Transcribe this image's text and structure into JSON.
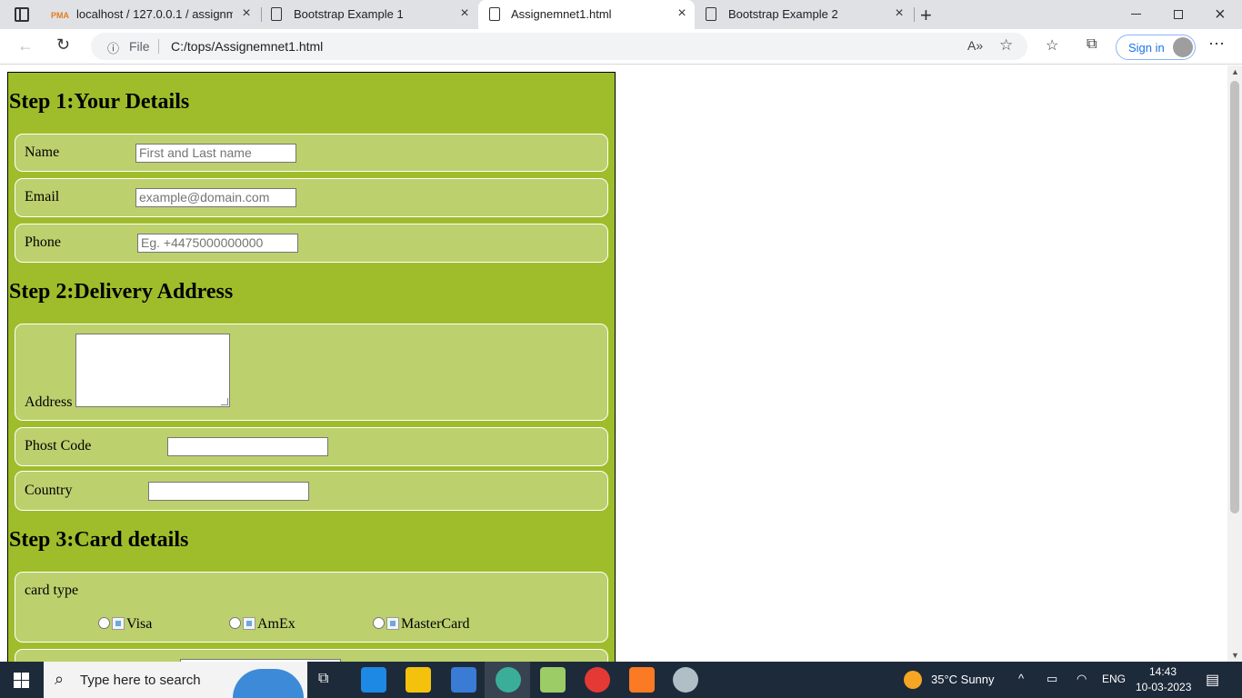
{
  "browser": {
    "tabs": [
      {
        "title": "localhost / 127.0.0.1 / assignmen",
        "icon": "phpmyadmin-icon",
        "active": false
      },
      {
        "title": "Bootstrap Example 1",
        "icon": "page-icon",
        "active": false
      },
      {
        "title": "Assignemnet1.html",
        "icon": "page-icon",
        "active": true
      },
      {
        "title": "Bootstrap Example 2",
        "icon": "page-icon",
        "active": false
      }
    ],
    "address": {
      "scheme_label": "File",
      "url": "C:/tops/Assignemnet1.html"
    },
    "sign_in_label": "Sign in"
  },
  "form": {
    "step1": {
      "heading": "Step 1:Your Details",
      "name_label": "Name",
      "name_placeholder": "First and Last name",
      "email_label": "Email",
      "email_placeholder": "example@domain.com",
      "phone_label": "Phone",
      "phone_placeholder": "Eg. +4475000000000"
    },
    "step2": {
      "heading": "Step 2:Delivery Address",
      "address_label": "Address",
      "postcode_label": "Phost Code",
      "country_label": "Country"
    },
    "step3": {
      "heading": "Step 3:Card details",
      "card_type_label": "card type",
      "options": [
        "Visa",
        "AmEx",
        "MasterCard"
      ]
    }
  },
  "taskbar": {
    "search_placeholder": "Type here to search",
    "weather": "35°C  Sunny",
    "language": "ENG",
    "time": "14:43",
    "date": "10-03-2023"
  },
  "colors": {
    "form_bg": "#9fbd2b",
    "fieldset_bg": "#bcd06e",
    "taskbar_bg": "#1d2a3a"
  }
}
